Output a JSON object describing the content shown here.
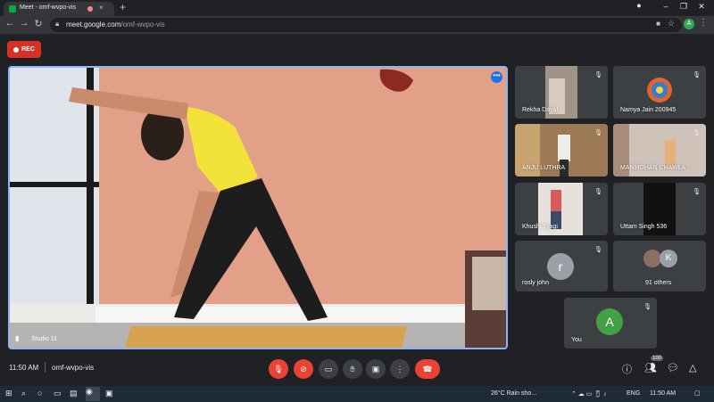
{
  "browser": {
    "tab_title": "Meet - omf-wvpo-vis",
    "tab_close": "×",
    "new_tab": "+",
    "url_host": "meet.google.com",
    "url_path": "/omf-wvpo-vis",
    "profile_initial": "A",
    "window_min": "–",
    "window_max": "❐",
    "window_close": "✕"
  },
  "rec_label": "REC",
  "main": {
    "speaker_name": "Studio 11",
    "more_label": "•••"
  },
  "participants": [
    {
      "name": "Rekha Dayal"
    },
    {
      "name": "Namya Jain 200945"
    },
    {
      "name": "ANJU LUTHRA"
    },
    {
      "name": "MANMOHAN CHAWLA"
    },
    {
      "name": "Khushi Tyagi"
    },
    {
      "name": "Uttam Singh 536"
    },
    {
      "name": "rosly john",
      "initial": "r"
    },
    {
      "name": "91 others",
      "initial": "K"
    },
    {
      "name": "You",
      "initial": "A"
    }
  ],
  "meeting": {
    "time": "11:50 AM",
    "code": "omf-wvpo-vis",
    "participant_count": "100"
  },
  "taskbar": {
    "weather": "26°C  Rain sho...",
    "lang": "ENG",
    "clock": "11:50 AM"
  },
  "colors": {
    "accent": "#8ab4f8",
    "danger": "#ea4335",
    "tile_bg": "#3c4043",
    "bg": "#202124"
  }
}
